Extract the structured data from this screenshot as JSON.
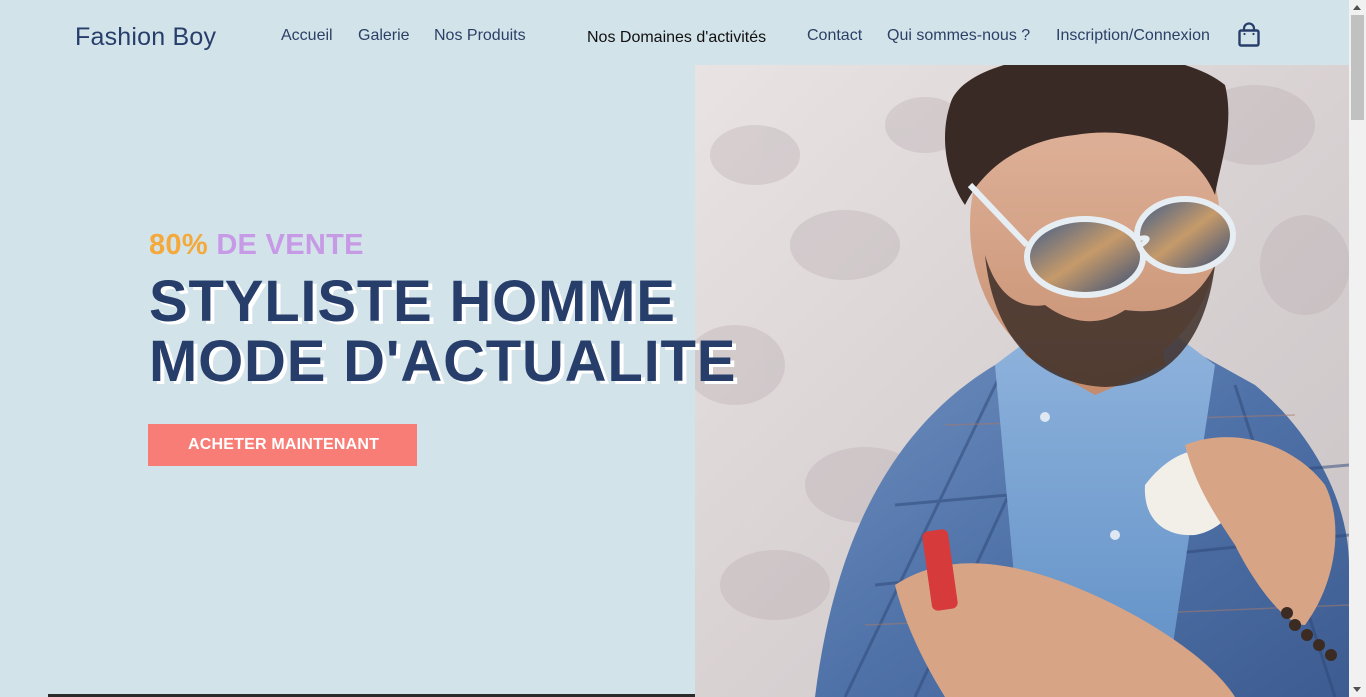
{
  "header": {
    "brand": "Fashion Boy",
    "nav": {
      "accueil": "Accueil",
      "galerie": "Galerie",
      "produits": "Nos Produits",
      "domaines": "Nos Domaines d'activités",
      "contact": "Contact",
      "qui": "Qui sommes-nous ?",
      "inscription": "Inscription/Connexion"
    },
    "cart_icon": "shopping-bag-icon"
  },
  "hero": {
    "promo_percent": "80%",
    "promo_text": "DE VENTE",
    "title_line1": "STYLISTE HOMME",
    "title_line2": "MODE D'ACTUALITE",
    "cta_label": "ACHETER MAINTENANT"
  },
  "colors": {
    "background": "#d2e3ea",
    "primary_text": "#273e6b",
    "promo_percent": "#f4a93a",
    "promo_text": "#c79ae6",
    "cta_background": "#f87d76",
    "cta_text": "#ffffff"
  }
}
